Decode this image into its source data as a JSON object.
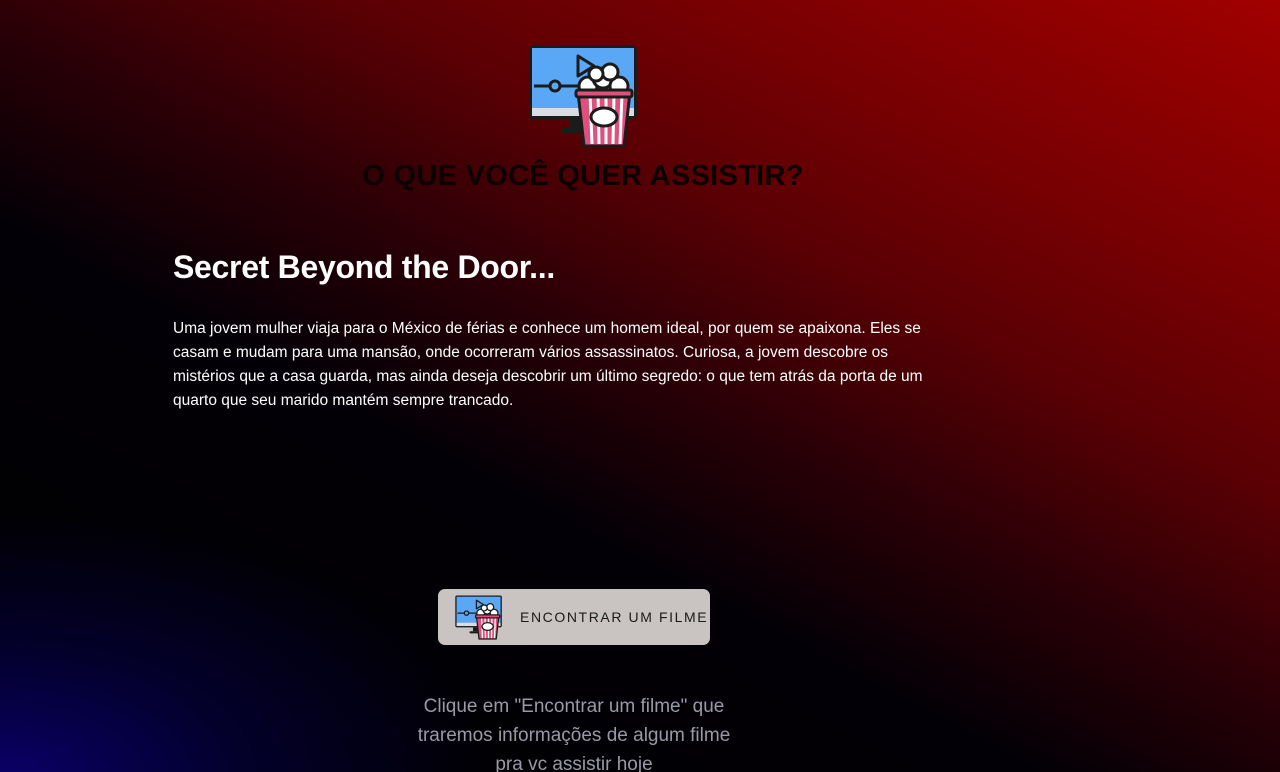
{
  "header": {
    "logo_icon": "movie-popcorn-icon",
    "title": "O QUE VOCÊ QUER ASSISTIR?"
  },
  "movie": {
    "title": "Secret Beyond the Door...",
    "description": "Uma jovem mulher viaja para o México de férias e conhece um homem ideal, por quem se apaixona. Eles se casam e mudam para uma mansão, onde ocorreram vários assassinatos. Curiosa, a jovem descobre os mistérios que a casa guarda, mas ainda deseja descobrir um último segredo: o que tem atrás da porta de um quarto que seu marido mantém sempre trancado."
  },
  "action": {
    "button_icon": "movie-popcorn-icon",
    "button_label": "ENCONTRAR UM FILME",
    "hint": "Clique em \"Encontrar um filme\" que traremos informações de algum filme pra vc assistir hoje"
  },
  "colors": {
    "background_top_right": "#a10000",
    "background_center": "#000000",
    "background_bottom_left": "#0a006e",
    "button_bg": "#c9c4c1",
    "hint_text": "#9a9aa6"
  }
}
